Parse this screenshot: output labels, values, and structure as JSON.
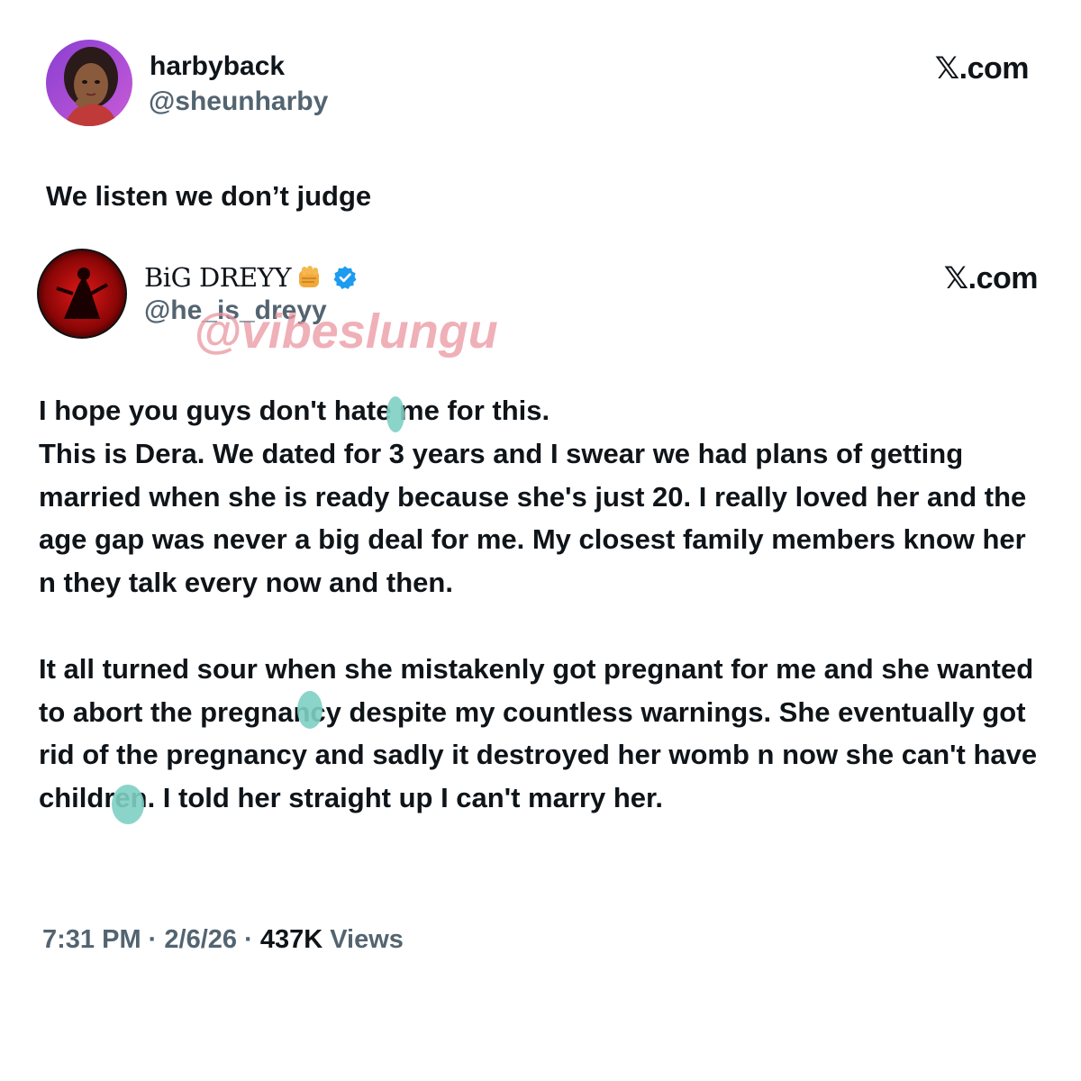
{
  "outer_tweet": {
    "display_name": "harbyback",
    "handle": "@sheunharby",
    "brand": "𝕏.com",
    "text": "We listen we don’t judge"
  },
  "quoted_tweet": {
    "display_name": "BiG DREYY",
    "handle": "@he_is_dreyy",
    "brand": "𝕏.com",
    "verified": true,
    "icons": [
      "fist-emoji-icon",
      "verified-badge-icon"
    ],
    "paragraphs": [
      "I hope you guys don't hate me for this.\nThis is Dera. We dated for 3 years and I swear we had plans of getting married when she is ready because she's just 20. I really loved her and the age gap was never a big deal for me. My closest family members know her n they talk every now and then.",
      "It all turned sour when she mistakenly got pregnant for me and she wanted to abort the pregnancy despite my countless warnings. She eventually got rid of the pregnancy and sadly it destroyed her womb n now she can't have children. I told her straight up I can't marry her."
    ],
    "time": "7:31 PM",
    "date": "2/6/26",
    "separator": "·",
    "views_count": "437K",
    "views_label": "Views"
  },
  "watermark": "@vibeslungu",
  "colors": {
    "text": "#0f1419",
    "secondary": "#536471",
    "verified_blue": "#1d9bf0",
    "watermark": "#e996a0",
    "censor_blob": "#7ecfc4"
  }
}
